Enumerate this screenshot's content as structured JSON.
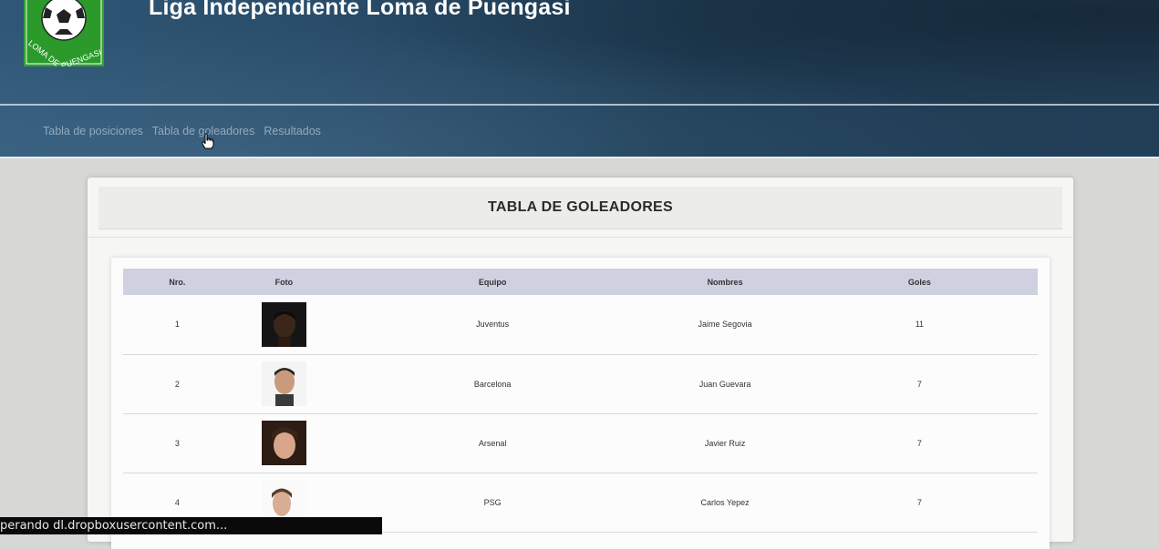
{
  "header": {
    "title": "Liga Independiente Loma de Puengasi",
    "logo_text": "LOMA DE PUENGASI"
  },
  "nav": {
    "items": [
      {
        "label": "Tabla de posiciones"
      },
      {
        "label": "Tabla de goleadores"
      },
      {
        "label": "Resultados"
      }
    ]
  },
  "card": {
    "title": "TABLA DE GOLEADORES"
  },
  "table": {
    "columns": [
      "Nro.",
      "Foto",
      "Equipo",
      "Nombres",
      "Goles"
    ],
    "rows": [
      {
        "nro": "1",
        "equipo": "Juventus",
        "nombre": "Jaime Segovia",
        "goles": "11"
      },
      {
        "nro": "2",
        "equipo": "Barcelona",
        "nombre": "Juan Guevara",
        "goles": "7"
      },
      {
        "nro": "3",
        "equipo": "Arsenal",
        "nombre": "Javier Ruiz",
        "goles": "7"
      },
      {
        "nro": "4",
        "equipo": "PSG",
        "nombre": "Carlos Yepez",
        "goles": "7"
      }
    ]
  },
  "status": {
    "text": "perando dl.dropboxusercontent.com..."
  },
  "colors": {
    "header_bg": "#274a66",
    "nav_text": "#93a9bd",
    "table_header_bg": "#cfd1e0",
    "logo_green": "#2fa32f"
  }
}
